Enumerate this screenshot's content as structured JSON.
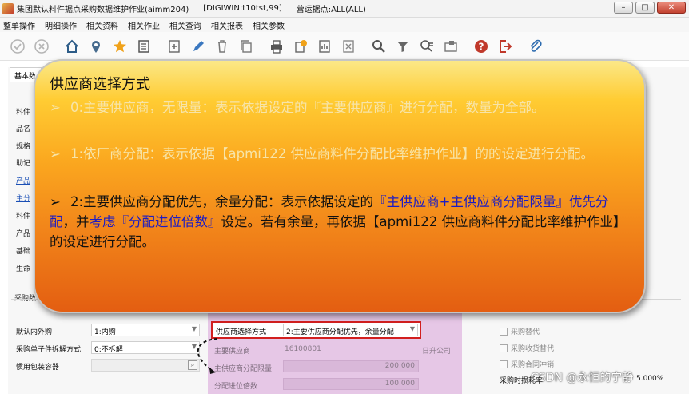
{
  "window": {
    "title": "集团默认料件据点采购数据维护作业(aimm204)",
    "server": "[DIGIWIN:t10tst,99]",
    "site": "营运据点:ALL(ALL)"
  },
  "menubar": [
    "整单操作",
    "明细操作",
    "相关资料",
    "相关作业",
    "相关查询",
    "相关报表",
    "相关参数"
  ],
  "toolbar": {
    "icons": [
      "check-icon",
      "cancel-icon",
      "home-icon",
      "location-icon",
      "star-icon",
      "list-icon",
      "add-icon",
      "edit-icon",
      "delete-icon",
      "copy-icon",
      "print-icon",
      "export-icon",
      "report-icon",
      "excel-icon",
      "search-icon",
      "filter-icon",
      "query-icon",
      "preview-icon",
      "help-icon",
      "exit-icon",
      "attach-icon"
    ]
  },
  "background": {
    "tab_label": "基本数",
    "side_labels": [
      "料件",
      "品名",
      "规格",
      "助记",
      "产品",
      "主分",
      "料件",
      "产品",
      "基础",
      "生命"
    ],
    "fieldset_title": "采购数",
    "fields": {
      "in_out_label": "默认内外购",
      "in_out_value": "1:内购",
      "split_label": "采购单子件拆解方式",
      "split_value": "0:不拆解",
      "container_label": "惯用包装容器",
      "supplier_select_label": "供应商选择方式",
      "supplier_select_value": "2:主要供应商分配优先，余量分配",
      "main_supplier_label": "主要供应商",
      "main_supplier_code": "16100801",
      "main_supplier_name": "日升公司",
      "limit_label": "主供应商分配限量",
      "limit_value": "200.000",
      "multiple_label": "分配进位倍数",
      "multiple_value": "100.000",
      "chk_substitute": "采购替代",
      "chk_receipt": "采购收货替代",
      "chk_contract": "采购合同冲销",
      "loss_label": "采购时损耗率",
      "loss_value": "5.000%"
    }
  },
  "callout": {
    "title": "供应商选择方式",
    "arrow": "➢",
    "item1": "0:主要供应商，无限量：表示依据设定的『主要供应商』进行分配，数量为全部。",
    "item2": "1:依厂商分配：表示依据【apmi122 供应商料件分配比率维护作业】的的设定进行分配。",
    "item3": {
      "p1": "2:主要供应商分配优先，余量分配：表示依据设定的",
      "em1": "『主供应商+主供应商分配限量』优先分配",
      "p2": "，并",
      "em2": "考虑『分配进位倍数』",
      "p3": "设定。若有余量，再依据【apmi122 供应商料件分配比率维护作业】的设定进行分配。"
    }
  },
  "watermark": "CSDN @永恒的宁静"
}
